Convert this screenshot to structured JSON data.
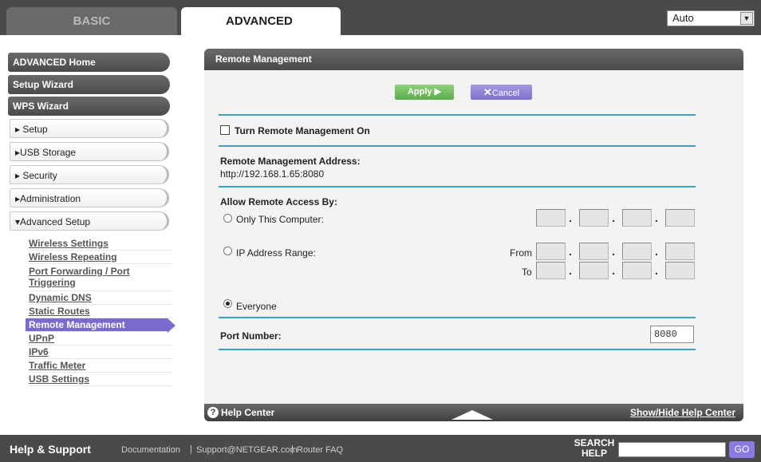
{
  "tabs": {
    "basic": "BASIC",
    "advanced": "ADVANCED"
  },
  "language": {
    "selected": "Auto"
  },
  "sidebar": {
    "dark_items": [
      "ADVANCED Home",
      "Setup Wizard",
      "WPS Wizard"
    ],
    "sections": [
      "▸ Setup",
      "▸USB Storage",
      "▸ Security",
      "▸Administration",
      "▾Advanced Setup"
    ],
    "sub_items": [
      "Wireless Settings",
      "Wireless Repeating",
      "Port Forwarding / Port Triggering",
      "Dynamic DNS",
      "Static Routes",
      "Remote Management",
      "UPnP",
      "IPv6",
      "Traffic Meter",
      "USB Settings"
    ],
    "active_sub_item": "Remote Management"
  },
  "panel": {
    "title": "Remote Management",
    "apply_label": "Apply ▶",
    "cancel_label": "Cancel",
    "turn_on_label": "Turn Remote Management On",
    "turn_on_checked": false,
    "address_label": "Remote Management Address:",
    "address_value": "http://192.168.1.65:8080",
    "access_label": "Allow Remote Access By:",
    "only_this_computer": "Only This Computer:",
    "ip_range": "IP Address Range:",
    "from_label": "From",
    "to_label": "To",
    "everyone": "Everyone",
    "selected_access": "Everyone",
    "port_label": "Port Number:",
    "port_value": "8080"
  },
  "help_bar": {
    "help_center": "Help Center",
    "toggle": "Show/Hide Help Center"
  },
  "footer": {
    "title": "Help & Support",
    "documentation": "Documentation",
    "support": "Support@NETGEAR.com",
    "faq": "Router FAQ",
    "search_label": "SEARCH HELP",
    "go": "GO"
  },
  "colors": {
    "accent_purple": "#7a6acb",
    "apply_green": "#5cad4a",
    "rule_blue": "#3aa0c4"
  }
}
